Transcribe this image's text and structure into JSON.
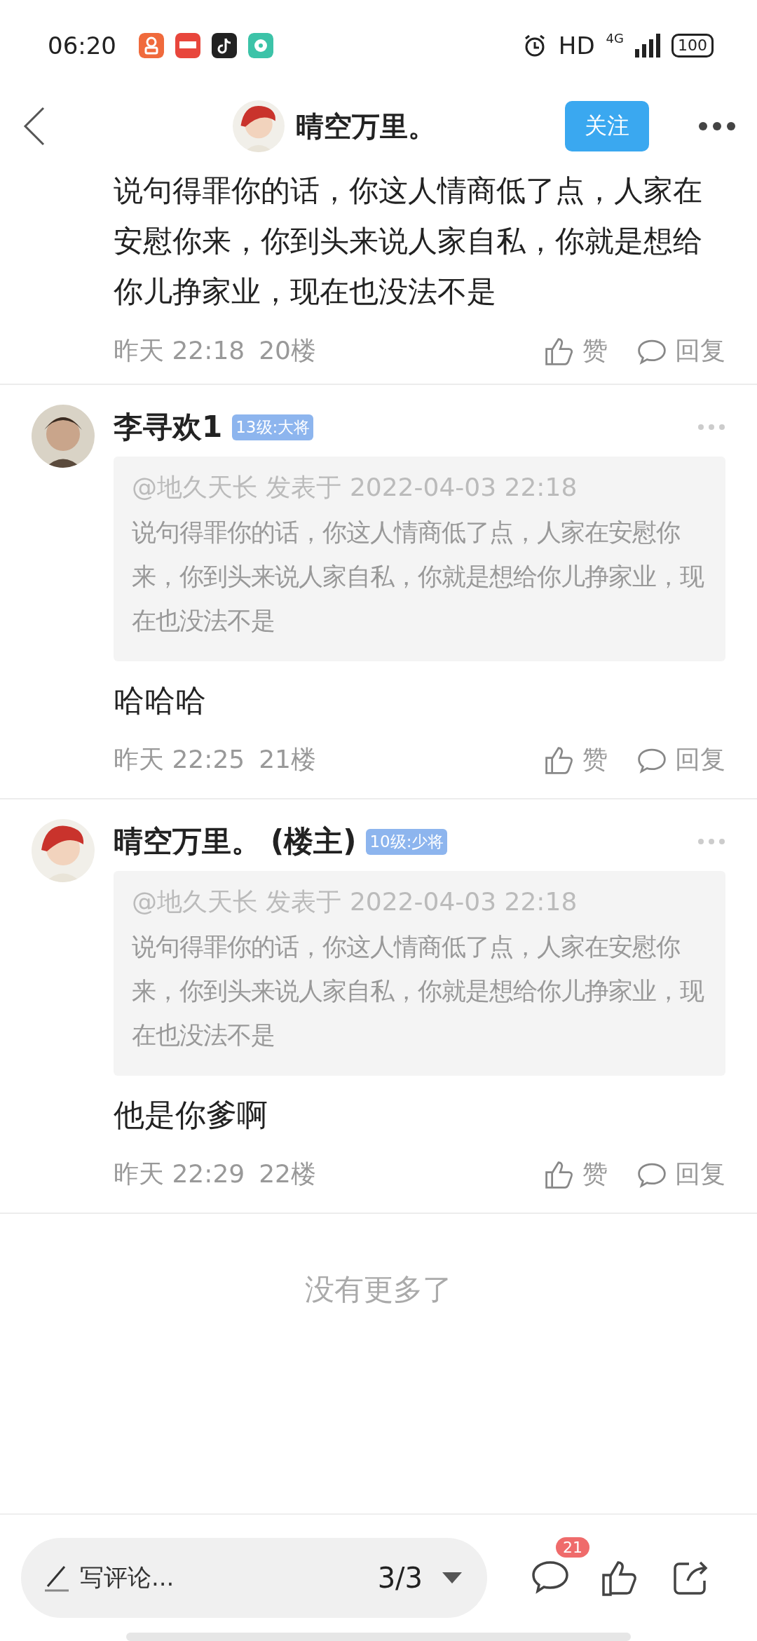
{
  "status_bar": {
    "time": "06:20",
    "hd": "HD",
    "network": "4G",
    "battery": "100"
  },
  "header": {
    "title": "晴空万里。",
    "follow": "关注"
  },
  "comments": [
    {
      "kind": "continued",
      "text": "说句得罪你的话，你这人情商低了点，人家在安慰你来，你到头来说人家自私，你就是想给你儿挣家业，现在也没法不是",
      "time": "昨天 22:18",
      "floor": "20楼",
      "like": "赞",
      "reply": "回复"
    },
    {
      "kind": "full",
      "author": "李寻欢1",
      "badge": "13级:大将",
      "quote": {
        "source": "@地久天长 发表于 2022-04-03 22:18",
        "text": "说句得罪你的话，你这人情商低了点，人家在安慰你来，你到头来说人家自私，你就是想给你儿挣家业，现在也没法不是"
      },
      "text": "哈哈哈",
      "time": "昨天 22:25",
      "floor": "21楼",
      "like": "赞",
      "reply": "回复"
    },
    {
      "kind": "full",
      "author": "晴空万里。",
      "op_tag": "(楼主)",
      "badge": "10级:少将",
      "quote": {
        "source": "@地久天长 发表于 2022-04-03 22:18",
        "text": "说句得罪你的话，你这人情商低了点，人家在安慰你来，你到头来说人家自私，你就是想给你儿挣家业，现在也没法不是"
      },
      "text": "他是你爹啊",
      "time": "昨天 22:29",
      "floor": "22楼",
      "like": "赞",
      "reply": "回复"
    }
  ],
  "end_note": "没有更多了",
  "bottom_bar": {
    "placeholder": "写评论...",
    "page": "3/3",
    "comment_count": "21"
  }
}
